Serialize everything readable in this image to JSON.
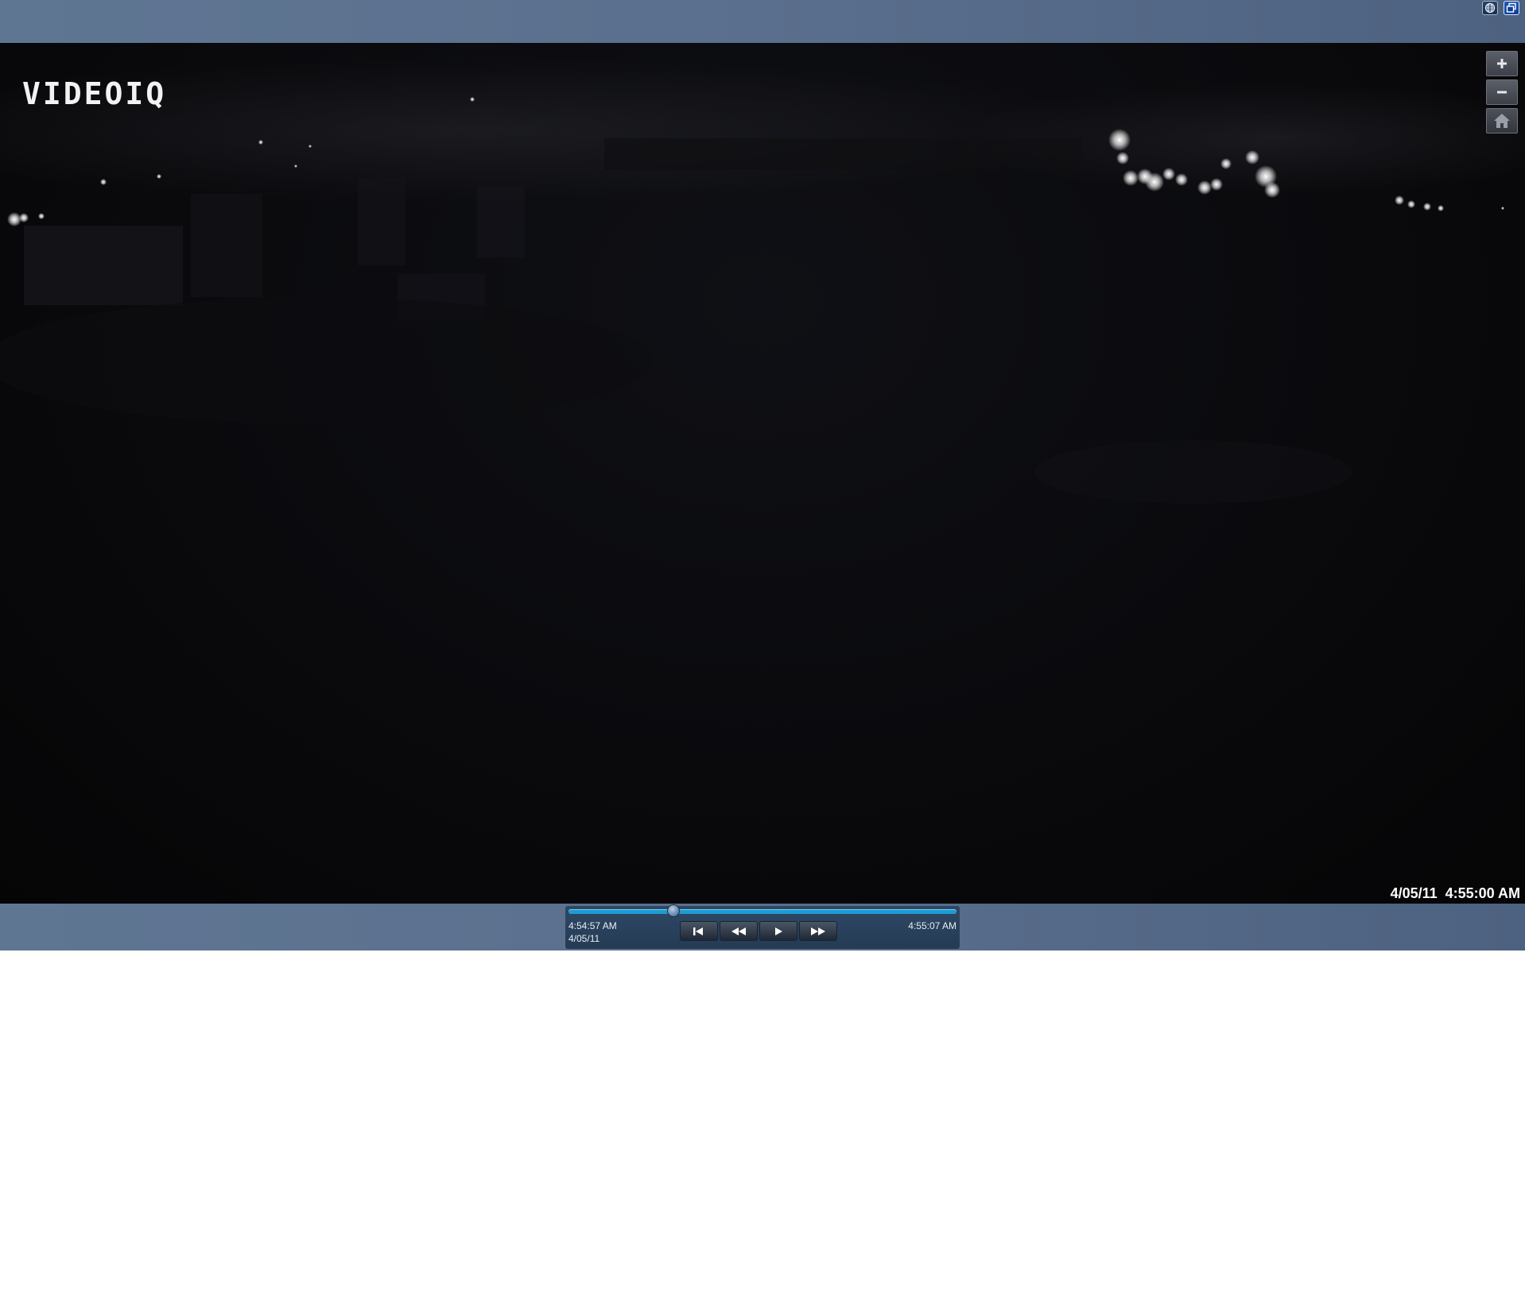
{
  "video": {
    "watermark": "VIDEOIQ",
    "timestamp": "4/05/11  4:55:00 AM"
  },
  "zoom_controls": {
    "zoom_in_icon": "plus-icon",
    "zoom_out_icon": "minus-icon",
    "home_icon": "home-icon"
  },
  "top_bar": {
    "icons": [
      "globe-icon",
      "restore-window-icon"
    ]
  },
  "playback": {
    "start_time": "4:54:57 AM",
    "start_date": "4/05/11",
    "end_time": "4:55:07 AM",
    "position_fraction": 0.27,
    "buttons": [
      "skip-to-start-icon",
      "rewind-icon",
      "play-icon",
      "fast-forward-icon"
    ]
  },
  "colors": {
    "bar": "#5a6f8d",
    "track": "#1e9bd3",
    "video_bg": "#0a0a0d"
  }
}
